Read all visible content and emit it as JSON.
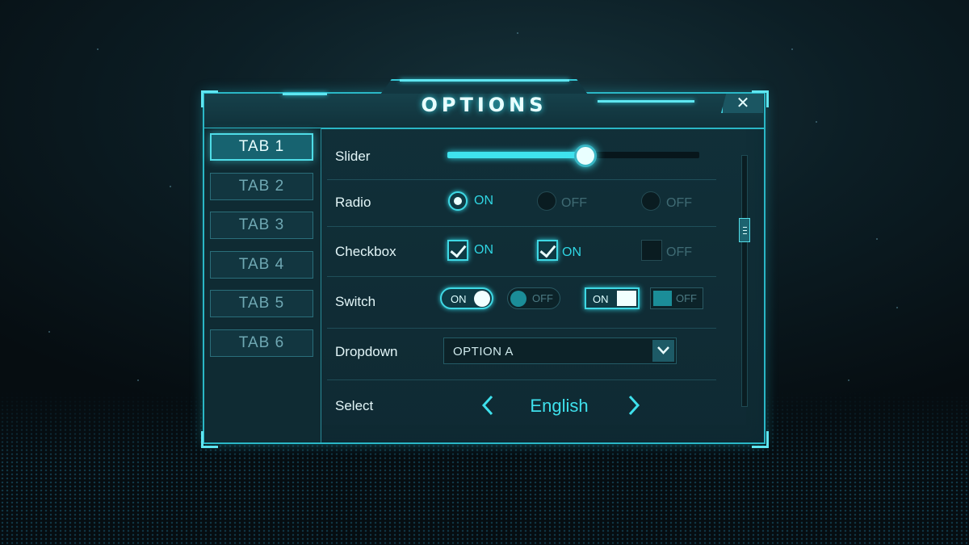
{
  "window": {
    "title": "OPTIONS",
    "close_label": "✕"
  },
  "tabs": [
    {
      "label": "TAB 1",
      "active": true
    },
    {
      "label": "TAB 2",
      "active": false
    },
    {
      "label": "TAB 3",
      "active": false
    },
    {
      "label": "TAB 4",
      "active": false
    },
    {
      "label": "TAB 5",
      "active": false
    },
    {
      "label": "TAB 6",
      "active": false
    }
  ],
  "settings": {
    "slider": {
      "label": "Slider",
      "value_fraction": 0.54
    },
    "radio": {
      "label": "Radio",
      "options": [
        "ON",
        "OFF",
        "OFF"
      ],
      "selected_index": 0
    },
    "checkbox": {
      "label": "Checkbox",
      "options": [
        {
          "text": "ON",
          "checked": true
        },
        {
          "text": "ON",
          "checked": true
        },
        {
          "text": "OFF",
          "checked": false
        }
      ]
    },
    "switch": {
      "label": "Switch",
      "items": [
        {
          "text": "ON",
          "on": true,
          "style": "pill"
        },
        {
          "text": "OFF",
          "on": false,
          "style": "pill"
        },
        {
          "text": "ON",
          "on": true,
          "style": "box"
        },
        {
          "text": "OFF",
          "on": false,
          "style": "box"
        }
      ]
    },
    "dropdown": {
      "label": "Dropdown",
      "value": "OPTION A"
    },
    "select": {
      "label": "Select",
      "value": "English"
    }
  },
  "icons": {
    "close": "close-icon",
    "dropdown_arrow": "chevron-down-icon",
    "select_prev": "chevron-left-icon",
    "select_next": "chevron-right-icon",
    "scroll_grip": "grip-icon"
  },
  "colors": {
    "accent": "#3fd8e4",
    "panel": "#0f2a33",
    "off": "#3f6b74"
  }
}
